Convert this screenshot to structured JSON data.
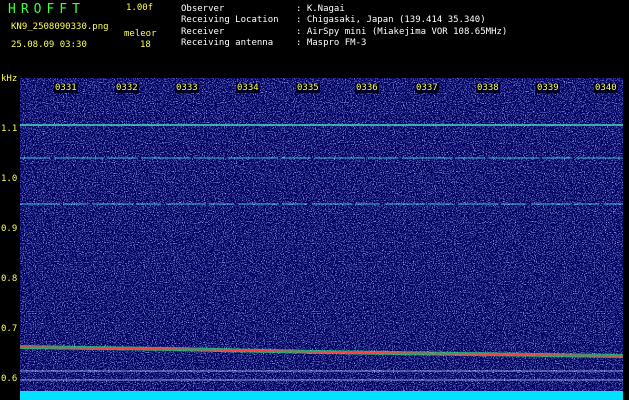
{
  "header": {
    "app_title": "HROFFT",
    "version": "1.00f",
    "filename": "KN9_2508090330.png",
    "station": "meleor",
    "datetime": "25.08.09 03:30",
    "count": "18"
  },
  "info": [
    {
      "key": "Observer",
      "value": ": K.Nagai"
    },
    {
      "key": "Receiving Location",
      "value": ": Chigasaki, Japan (139.414 35.340)"
    },
    {
      "key": "Receiver",
      "value": ": AirSpy mini (Miakejima VOR 108.65MHz)"
    },
    {
      "key": "Receiving antenna",
      "value": ": Maspro FM-3"
    }
  ],
  "axis": {
    "unit": "kHz",
    "ticks": [
      "1.1",
      "1.0",
      "0.9",
      "0.8",
      "0.7",
      "0.6"
    ],
    "time_labels": [
      "0331",
      "0332",
      "0333",
      "0334",
      "0335",
      "0336",
      "0337",
      "0338",
      "0339",
      "0340"
    ]
  },
  "colors": {
    "background": "#000000",
    "plot_bg": "#00005a",
    "label_yellow": "#ffff50",
    "title_green": "#3dff3d"
  }
}
